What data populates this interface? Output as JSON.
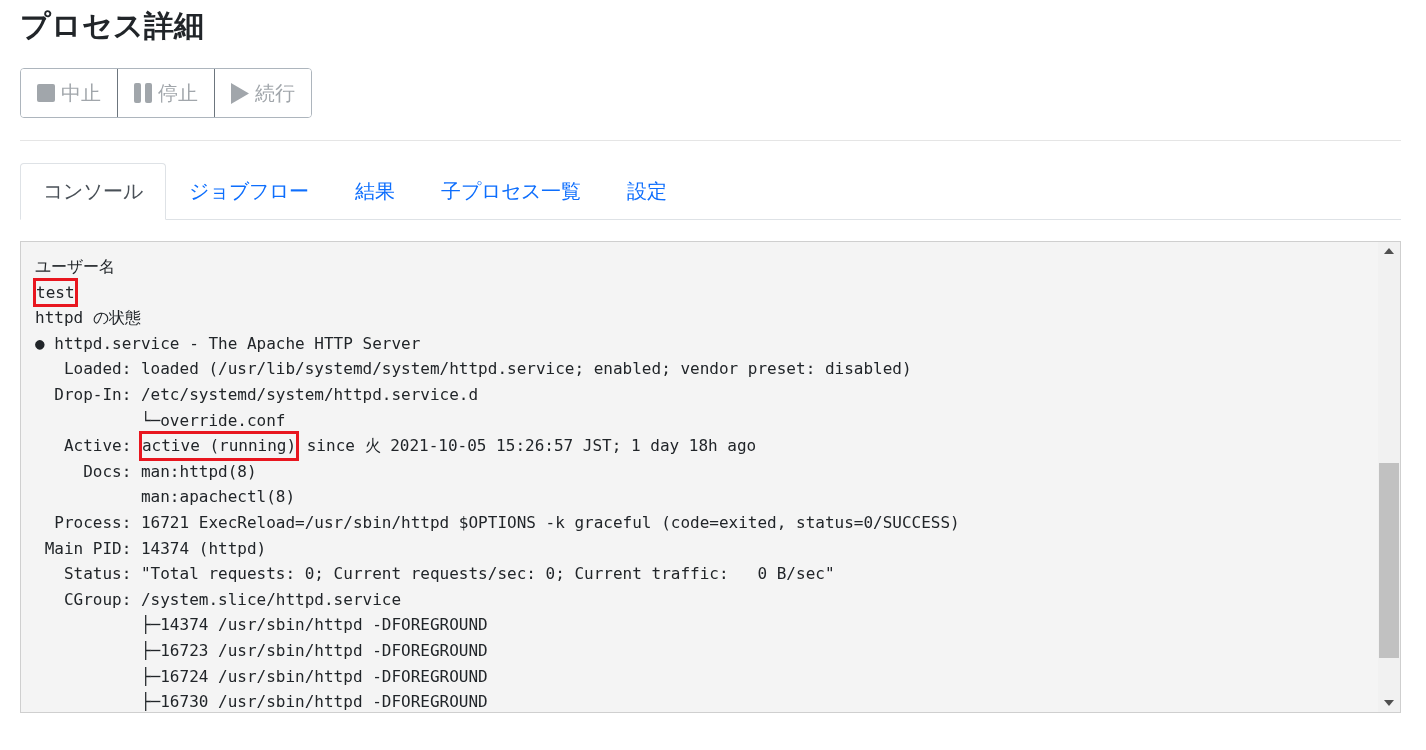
{
  "page": {
    "title": "プロセス詳細"
  },
  "buttons": [
    {
      "kind": "stop",
      "label": "中止",
      "disabled": true
    },
    {
      "kind": "pause",
      "label": "停止",
      "disabled": true
    },
    {
      "kind": "play",
      "label": "続行",
      "disabled": true
    }
  ],
  "tabs": [
    {
      "label": "コンソール",
      "selected": true
    },
    {
      "label": "ジョブフロー",
      "selected": false
    },
    {
      "label": "結果",
      "selected": false
    },
    {
      "label": "子プロセス一覧",
      "selected": false
    },
    {
      "label": "設定",
      "selected": false
    }
  ],
  "console": {
    "lines": [
      [
        {
          "text": "ユーザー名",
          "highlighted": false
        }
      ],
      [
        {
          "text": "test",
          "highlighted": true
        }
      ],
      [
        {
          "text": "httpd の状態",
          "highlighted": false
        }
      ],
      [
        {
          "text": "● httpd.service - The Apache HTTP Server",
          "highlighted": false
        }
      ],
      [
        {
          "text": "   Loaded: loaded (/usr/lib/systemd/system/httpd.service; enabled; vendor preset: disabled)",
          "highlighted": false
        }
      ],
      [
        {
          "text": "  Drop-In: /etc/systemd/system/httpd.service.d",
          "highlighted": false
        }
      ],
      [
        {
          "text": "           └─override.conf",
          "highlighted": false
        }
      ],
      [
        {
          "text": "   Active: ",
          "highlighted": false
        },
        {
          "text": "active (running)",
          "highlighted": true
        },
        {
          "text": " since 火 2021-10-05 15:26:57 JST; 1 day 18h ago",
          "highlighted": false
        }
      ],
      [
        {
          "text": "     Docs: man:httpd(8)",
          "highlighted": false
        }
      ],
      [
        {
          "text": "           man:apachectl(8)",
          "highlighted": false
        }
      ],
      [
        {
          "text": "  Process: 16721 ExecReload=/usr/sbin/httpd $OPTIONS -k graceful (code=exited, status=0/SUCCESS)",
          "highlighted": false
        }
      ],
      [
        {
          "text": " Main PID: 14374 (httpd)",
          "highlighted": false
        }
      ],
      [
        {
          "text": "   Status: \"Total requests: 0; Current requests/sec: 0; Current traffic:   0 B/sec\"",
          "highlighted": false
        }
      ],
      [
        {
          "text": "   CGroup: /system.slice/httpd.service",
          "highlighted": false
        }
      ],
      [
        {
          "text": "           ├─14374 /usr/sbin/httpd -DFOREGROUND",
          "highlighted": false
        }
      ],
      [
        {
          "text": "           ├─16723 /usr/sbin/httpd -DFOREGROUND",
          "highlighted": false
        }
      ],
      [
        {
          "text": "           ├─16724 /usr/sbin/httpd -DFOREGROUND",
          "highlighted": false
        }
      ],
      [
        {
          "text": "           ├─16730 /usr/sbin/httpd -DFOREGROUND",
          "highlighted": false
        }
      ]
    ]
  }
}
